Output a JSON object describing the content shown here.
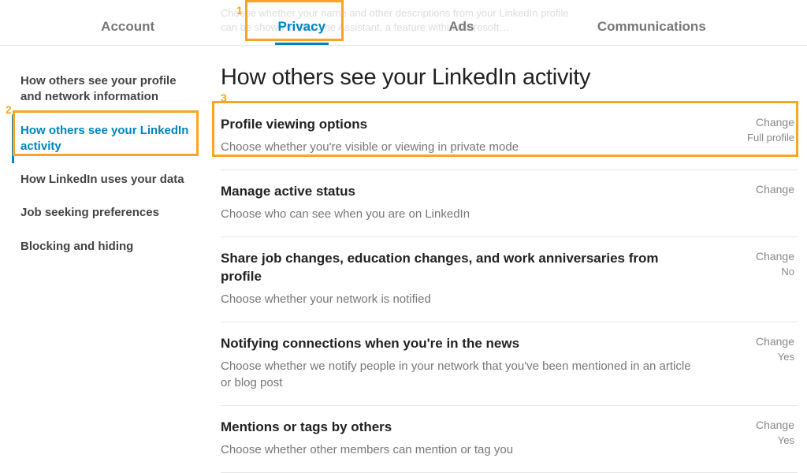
{
  "tabs": {
    "account": "Account",
    "privacy": "Privacy",
    "ads": "Ads",
    "communications": "Communications"
  },
  "faded": "Choose whether your name and other descriptions from your LinkedIn profile can be shown in Resume Assistant, a feature within Microsoft…",
  "sidebar": {
    "item0": "How others see your profile and network information",
    "item1": "How others see your LinkedIn activity",
    "item2": "How LinkedIn uses your data",
    "item3": "Job seeking preferences",
    "item4": "Blocking and hiding"
  },
  "main": {
    "title": "How others see your LinkedIn activity",
    "change": "Change",
    "s0": {
      "title": "Profile viewing options",
      "desc": "Choose whether you're visible or viewing in private mode",
      "value": "Full profile"
    },
    "s1": {
      "title": "Manage active status",
      "desc": "Choose who can see when you are on LinkedIn",
      "value": ""
    },
    "s2": {
      "title": "Share job changes, education changes, and work anniversaries from profile",
      "desc": "Choose whether your network is notified",
      "value": "No"
    },
    "s3": {
      "title": "Notifying connections when you're in the news",
      "desc": "Choose whether we notify people in your network that you've been mentioned in an article or blog post",
      "value": "Yes"
    },
    "s4": {
      "title": "Mentions or tags by others",
      "desc": "Choose whether other members can mention or tag you",
      "value": "Yes"
    }
  },
  "annotations": {
    "n1": "1",
    "n2": "2",
    "n3": "3"
  }
}
